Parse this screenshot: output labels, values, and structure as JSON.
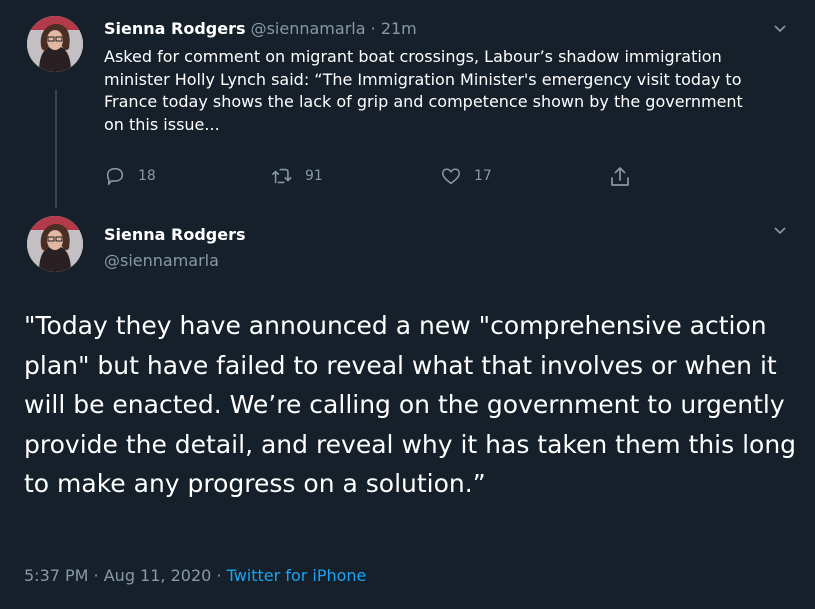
{
  "tweet1": {
    "name": "Sienna Rodgers",
    "handle": "@siennamarla",
    "separator": "·",
    "time": "21m",
    "text": "Asked for comment on migrant boat crossings, Labour’s shadow immigration minister Holly Lynch said: “The Immigration Minister's emergency visit today to France today shows the lack of grip and competence shown by the government on this issue...",
    "replies": "18",
    "retweets": "91",
    "likes": "17"
  },
  "tweet2": {
    "name": "Sienna Rodgers",
    "handle": "@siennamarla",
    "text": "\"Today they have announced a new \"comprehensive action plan\" but have failed to reveal what that involves or when it will be enacted. We’re calling on the government to urgently provide the detail, and reveal why it has taken them this long to make any progress on a solution.”",
    "timestamp": "5:37 PM · Aug 11, 2020",
    "separator": "·",
    "source": "Twitter for iPhone"
  },
  "colors": {
    "background": "#15202b",
    "text": "#ffffff",
    "muted": "#8899a6",
    "link": "#1da1f2",
    "divider": "#38444d"
  },
  "icons": [
    "avatar",
    "chevron-down-icon",
    "reply-icon",
    "retweet-icon",
    "like-icon",
    "share-icon"
  ]
}
